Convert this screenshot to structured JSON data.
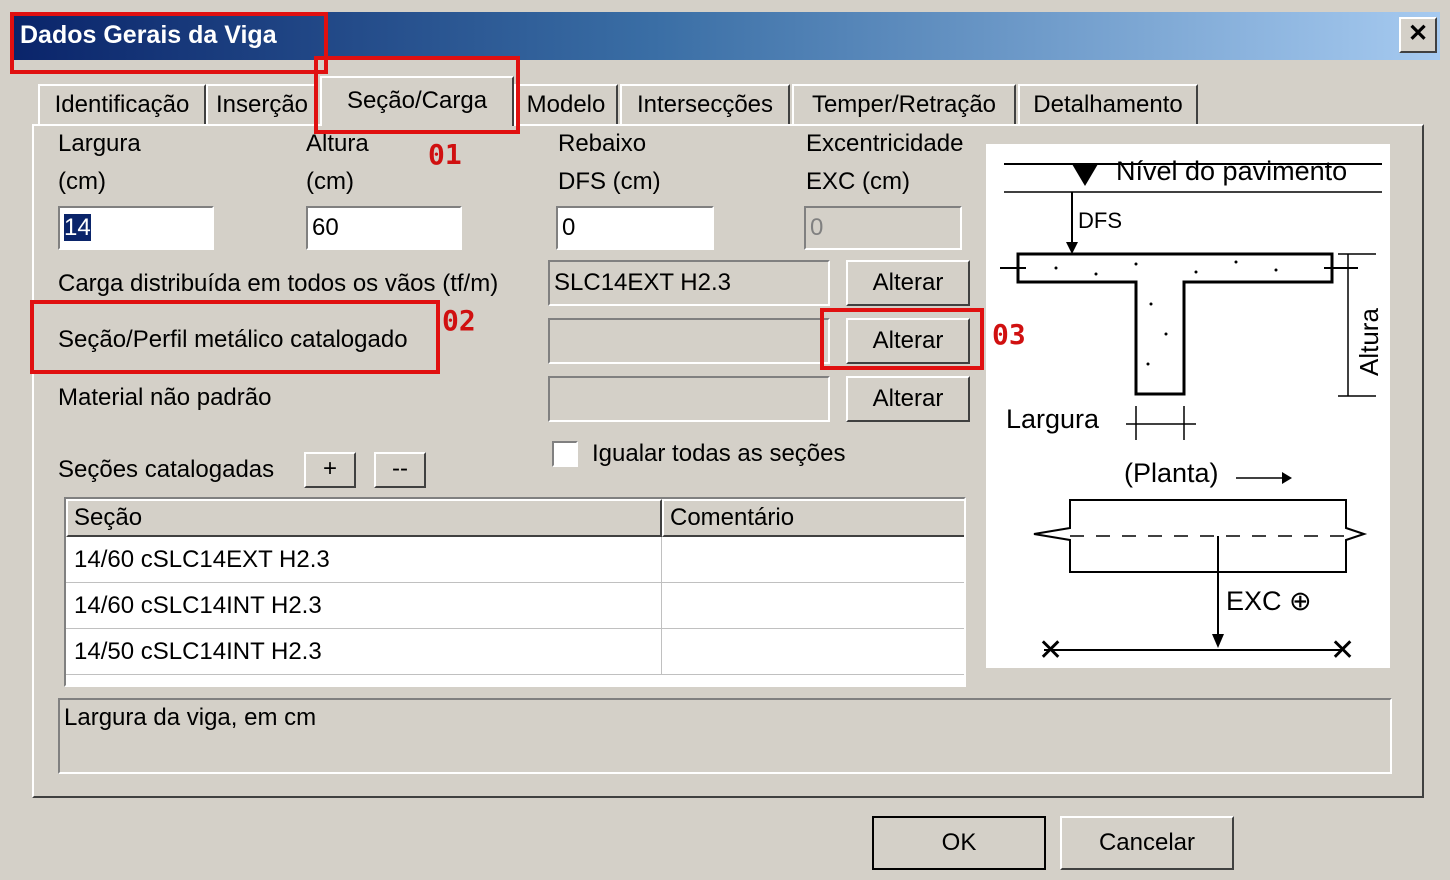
{
  "window": {
    "title": "Dados Gerais da Viga",
    "close_label": "✕"
  },
  "tabs": [
    {
      "label": "Identificação"
    },
    {
      "label": "Inserção"
    },
    {
      "label": "Seção/Carga"
    },
    {
      "label": "Modelo"
    },
    {
      "label": "Intersecções"
    },
    {
      "label": "Temper/Retração"
    },
    {
      "label": "Detalhamento"
    }
  ],
  "fields": {
    "largura": {
      "label1": "Largura",
      "label2": "(cm)",
      "value": "14"
    },
    "altura": {
      "label1": "Altura",
      "label2": "(cm)",
      "value": "60"
    },
    "rebaixo": {
      "label1": "Rebaixo",
      "label2": "DFS (cm)",
      "value": "0"
    },
    "excentricidade": {
      "label1": "Excentricidade",
      "label2": "EXC (cm)",
      "value": "0"
    }
  },
  "rows": {
    "carga": {
      "label": "Carga distribuída em todos os vãos (tf/m)",
      "value": "SLC14EXT H2.3",
      "button": "Alterar"
    },
    "secao": {
      "label": "Seção/Perfil metálico catalogado",
      "value": "",
      "button": "Alterar"
    },
    "material": {
      "label": "Material não padrão",
      "value": "",
      "button": "Alterar"
    }
  },
  "igualar": {
    "label": "Igualar todas as seções",
    "checked": false
  },
  "catalog": {
    "label": "Seções catalogadas",
    "add": "+",
    "remove": "--",
    "headers": [
      "Seção",
      "Comentário"
    ],
    "rows": [
      {
        "secao": "14/60 cSLC14EXT H2.3",
        "comentario": ""
      },
      {
        "secao": "14/60 cSLC14INT H2.3",
        "comentario": ""
      },
      {
        "secao": "14/50 cSLC14INT H2.3",
        "comentario": ""
      }
    ]
  },
  "status": "Largura da viga, em cm",
  "buttons": {
    "ok": "OK",
    "cancel": "Cancelar"
  },
  "annotations": [
    "01",
    "02",
    "03"
  ],
  "diagram": {
    "nivel": "Nível do pavimento",
    "dfs": "DFS",
    "altura": "Altura",
    "largura": "Largura",
    "planta": "(Planta)",
    "exc": "EXC ⊕"
  },
  "colors": {
    "annotation_red": "#e01010",
    "title_start": "#0a246a",
    "title_end": "#a6caf0",
    "face": "#d4d0c8"
  }
}
